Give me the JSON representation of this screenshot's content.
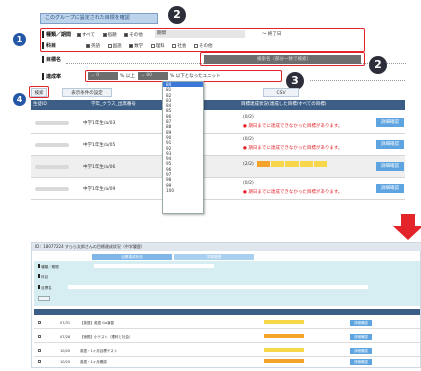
{
  "top_button": "このグループに設定された目標を確認",
  "callouts": {
    "c1": "1",
    "c2a": "2",
    "c2b": "2",
    "c3": "3",
    "c4": "4"
  },
  "filters": {
    "type_period_label": "種類／期間",
    "type_opts": [
      "すべて",
      "宿題",
      "その他"
    ],
    "period_value": "期間",
    "period_end": "〜 終了日",
    "subject_label": "科目",
    "subjects": [
      "英語",
      "国語",
      "数学",
      "理科",
      "社会",
      "その他"
    ],
    "target_name_label": "目標名",
    "target_name_placeholder": "検索名（部分一致で検索）",
    "rate_label": "達成率",
    "rate_from": "0",
    "rate_from_suffix": "% 以上",
    "rate_to": "80",
    "rate_to_suffix": "% 以下となったユニット",
    "search_button": "検索",
    "condition_button": "表示条件の設定",
    "csv_button": "CSV"
  },
  "dropdown_options": [
    "80",
    "81",
    "82",
    "83",
    "84",
    "85",
    "86",
    "87",
    "88",
    "89",
    "90",
    "91",
    "92",
    "93",
    "94",
    "95",
    "96",
    "97",
    "98",
    "99",
    "100"
  ],
  "table": {
    "headers": [
      "生徒ID",
      "学年_クラス_出席番号",
      "目標達成状況(達成した目標/すべての目標)"
    ],
    "rows": [
      {
        "class": "中学1年生/a/03",
        "progress": "(0/2)",
        "msg": "期日までに達成できなかった目標があります。",
        "button": "詳細確認"
      },
      {
        "class": "中学1年生/a/05",
        "progress": "(0/2)",
        "msg": "期日までに達成できなかった目標があります。",
        "button": "詳細確認"
      },
      {
        "class": "中学1年生/a/06",
        "progress": "(2/2)",
        "msg": "期日までに達成できなかった目標があります。",
        "button": "詳細確認"
      },
      {
        "class": "中学1年生/a/09",
        "progress": "(0/2)",
        "msg": "期日までに達成できなかった目標があります。",
        "button": "詳細確認"
      }
    ]
  },
  "detail": {
    "header": "ID：18077224 すらら太郎さんの目標達成状況（中学履歴）",
    "tab1": "目標達成状況",
    "tab2": "学習履歴",
    "rows": [
      {
        "date": "07/31",
        "title": "【英語】英語 Go演習",
        "button": "詳細確認"
      },
      {
        "date": "07/28",
        "title": "【宿題】小テスト（理科と社会）",
        "button": "詳細確認"
      },
      {
        "date": "10/20",
        "title": "英語・1ヶ月目標テスト",
        "button": "詳細確認"
      },
      {
        "date": "10/20",
        "title": "英語・1ヶ月確認",
        "button": "詳細確認"
      }
    ]
  },
  "colors": {
    "accent_red": "#e3242b",
    "header_blue": "#3c5e86",
    "detail_blue": "#5ea4e0",
    "progress_orange": "#f4a32a",
    "progress_yellow": "#f7d64a"
  }
}
